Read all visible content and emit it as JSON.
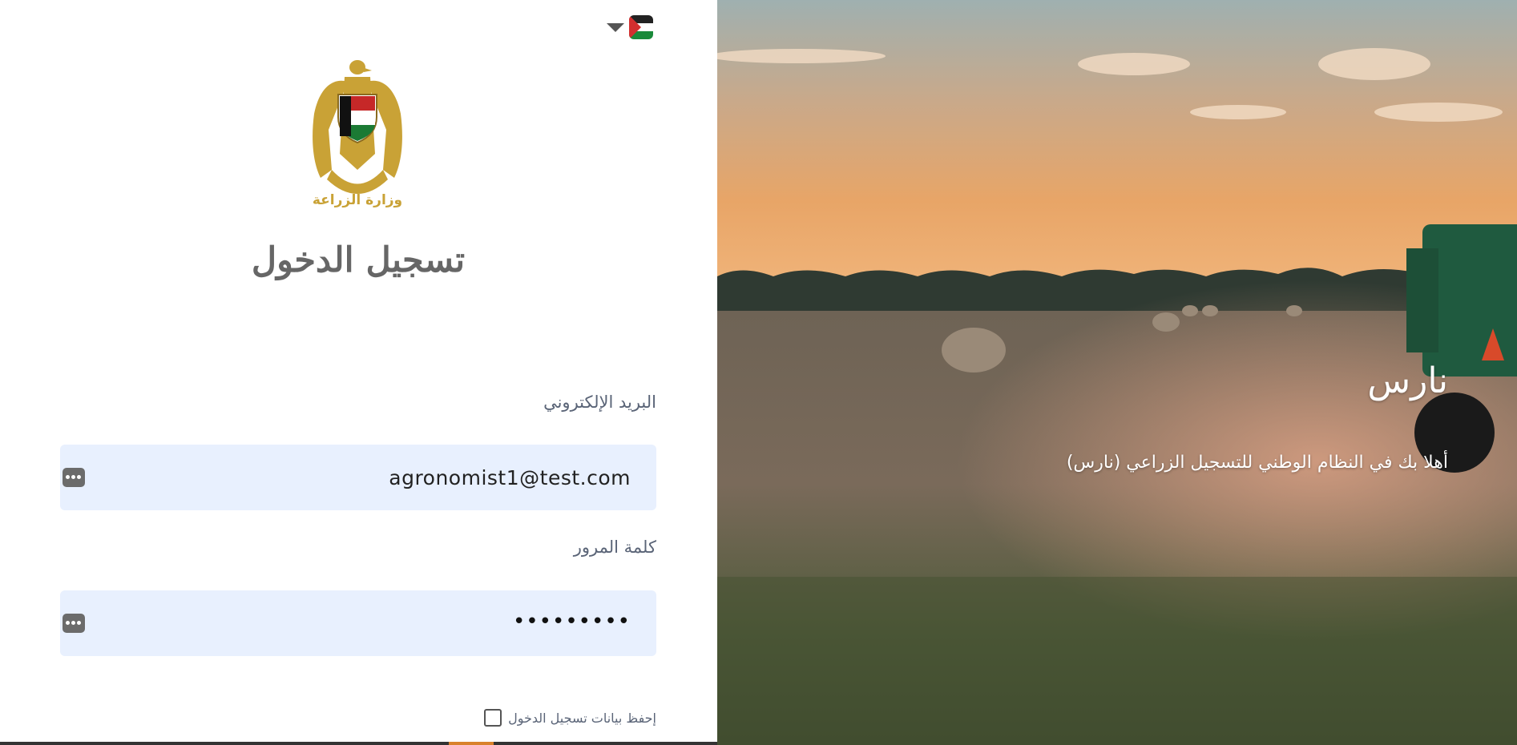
{
  "language_selector": {
    "flag_icon": "palestine-flag-icon",
    "caret_icon": "caret-down-icon"
  },
  "logo": {
    "text": "وزارة الزراعة",
    "emblem": "eagle-emblem"
  },
  "page_title": "تسجيل الدخول",
  "email": {
    "label": "البريد الإلكتروني",
    "value": "agronomist1@test.com",
    "icon": "password-manager-icon"
  },
  "password": {
    "label": "كلمة المرور",
    "masked_value": "•••••••••",
    "icon": "password-manager-icon"
  },
  "remember_me": {
    "label": "إحفظ بيانات تسجيل الدخول",
    "checked": false
  },
  "hero": {
    "title": "نارس",
    "subtitle": "أهلا بك في النظام الوطني للتسجيل الزراعي (نارس)"
  },
  "colors": {
    "accent_gold": "#c9a236",
    "input_bg": "#e8f0fe",
    "label": "#5a6477",
    "title": "#666666"
  }
}
